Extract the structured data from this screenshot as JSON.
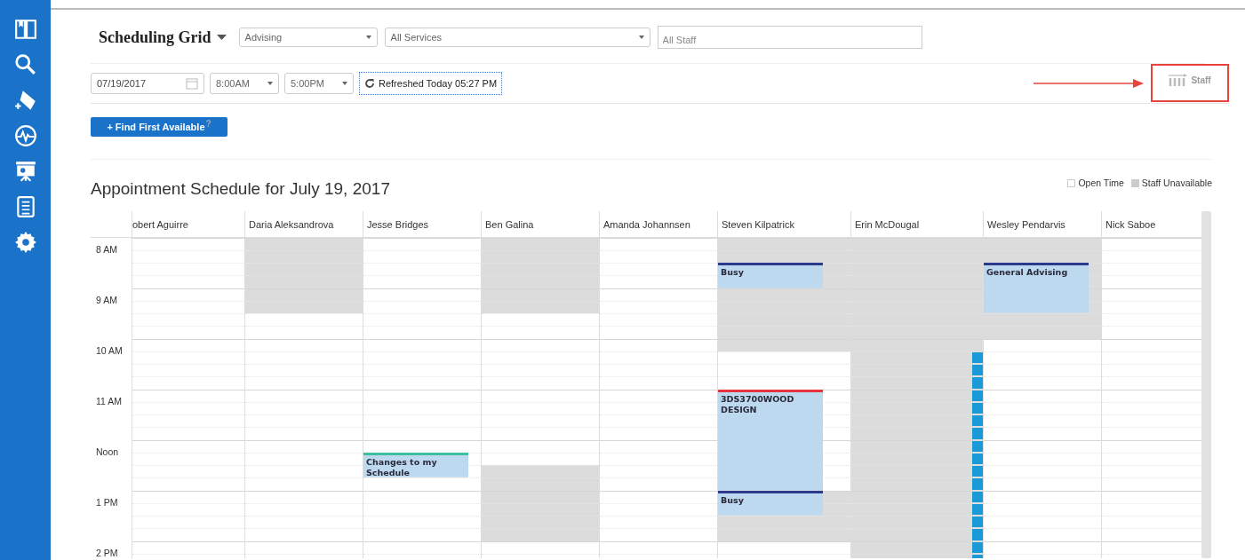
{
  "header": {
    "title": "Scheduling Grid",
    "selects": [
      {
        "value": "Advising"
      },
      {
        "value": "All Services"
      }
    ],
    "staff_field": {
      "placeholder": "All Staff"
    }
  },
  "filters": {
    "date": "07/19/2017",
    "start_time": "8:00AM",
    "end_time": "5:00PM",
    "refresh_button": "Refreshed Today 05:27 PM",
    "view_toggle": "Staff"
  },
  "find_button": {
    "label": "+ Find First Available",
    "help": "?"
  },
  "schedule": {
    "title": "Appointment Schedule for July 19, 2017",
    "legend": [
      {
        "label": "Open Time",
        "kind": "open"
      },
      {
        "label": "Staff Unavailable",
        "kind": "unavailable"
      }
    ],
    "hours": [
      "8 AM",
      "9 AM",
      "10 AM",
      "11 AM",
      "Noon",
      "1 PM",
      "2 PM"
    ],
    "staff": [
      {
        "name": "obert Aguirre",
        "slots": [
          {
            "unavailable": false
          },
          {
            "unavailable": false
          },
          {
            "unavailable": false
          },
          {
            "unavailable": false
          },
          {
            "unavailable": false
          },
          {
            "unavailable": false
          },
          {
            "unavailable": false
          },
          {
            "unavailable": false
          },
          {
            "unavailable": false
          },
          {
            "unavailable": false
          },
          {
            "unavailable": false
          },
          {
            "unavailable": false
          },
          {
            "unavailable": false
          },
          {
            "unavailable": false
          },
          {
            "unavailable": false
          },
          {
            "unavailable": false
          },
          {
            "unavailable": false
          },
          {
            "unavailable": false
          },
          {
            "unavailable": false
          },
          {
            "unavailable": false
          },
          {
            "unavailable": false
          },
          {
            "unavailable": false
          },
          {
            "unavailable": false
          },
          {
            "unavailable": false
          },
          {
            "unavailable": false
          },
          {
            "unavailable": false
          }
        ]
      },
      {
        "name": "Daria Aleksandrova",
        "slots": [
          {
            "unavailable": true
          },
          {
            "unavailable": true
          },
          {
            "unavailable": true
          },
          {
            "unavailable": true
          },
          {
            "unavailable": true
          },
          {
            "unavailable": true
          },
          {
            "unavailable": false
          },
          {
            "unavailable": false
          },
          {
            "unavailable": false
          },
          {
            "unavailable": false
          },
          {
            "unavailable": false
          },
          {
            "unavailable": false
          },
          {
            "unavailable": false
          },
          {
            "unavailable": false
          },
          {
            "unavailable": false
          },
          {
            "unavailable": false
          },
          {
            "unavailable": false
          },
          {
            "unavailable": false
          },
          {
            "unavailable": false
          },
          {
            "unavailable": false
          },
          {
            "unavailable": false
          },
          {
            "unavailable": false
          },
          {
            "unavailable": false
          },
          {
            "unavailable": false
          },
          {
            "unavailable": false
          },
          {
            "unavailable": false
          }
        ]
      },
      {
        "name": "Jesse Bridges",
        "slots": [
          {
            "unavailable": false
          },
          {
            "unavailable": false
          },
          {
            "unavailable": false
          },
          {
            "unavailable": false
          },
          {
            "unavailable": false
          },
          {
            "unavailable": false
          },
          {
            "unavailable": false
          },
          {
            "unavailable": false
          },
          {
            "unavailable": false
          },
          {
            "unavailable": false
          },
          {
            "unavailable": false
          },
          {
            "unavailable": false
          },
          {
            "unavailable": false
          },
          {
            "unavailable": false
          },
          {
            "unavailable": false
          },
          {
            "unavailable": false
          },
          {
            "unavailable": false
          },
          {
            "unavailable": false,
            "appointment": {
              "title": "Changes to my Schedule",
              "color": "#3cc0a0"
            }
          },
          {
            "unavailable": false,
            "continued": true
          },
          {
            "unavailable": false
          },
          {
            "unavailable": false
          },
          {
            "unavailable": false
          },
          {
            "unavailable": false
          },
          {
            "unavailable": false
          },
          {
            "unavailable": false
          },
          {
            "unavailable": false
          }
        ]
      },
      {
        "name": "Ben Galina",
        "slots": [
          {
            "unavailable": true
          },
          {
            "unavailable": true
          },
          {
            "unavailable": true
          },
          {
            "unavailable": true
          },
          {
            "unavailable": true
          },
          {
            "unavailable": true
          },
          {
            "unavailable": false
          },
          {
            "unavailable": false
          },
          {
            "unavailable": false
          },
          {
            "unavailable": false
          },
          {
            "unavailable": false
          },
          {
            "unavailable": false
          },
          {
            "unavailable": false
          },
          {
            "unavailable": false
          },
          {
            "unavailable": false
          },
          {
            "unavailable": false
          },
          {
            "unavailable": false
          },
          {
            "unavailable": false
          },
          {
            "unavailable": true
          },
          {
            "unavailable": true
          },
          {
            "unavailable": true
          },
          {
            "unavailable": true
          },
          {
            "unavailable": true
          },
          {
            "unavailable": true
          },
          {
            "unavailable": false
          },
          {
            "unavailable": false
          }
        ]
      },
      {
        "name": "Amanda Johannsen",
        "slots": [
          {
            "unavailable": false
          },
          {
            "unavailable": false
          },
          {
            "unavailable": false
          },
          {
            "unavailable": false
          },
          {
            "unavailable": false
          },
          {
            "unavailable": false
          },
          {
            "unavailable": false
          },
          {
            "unavailable": false
          },
          {
            "unavailable": false
          },
          {
            "unavailable": false
          },
          {
            "unavailable": false
          },
          {
            "unavailable": false
          },
          {
            "unavailable": false
          },
          {
            "unavailable": false
          },
          {
            "unavailable": false
          },
          {
            "unavailable": false
          },
          {
            "unavailable": false
          },
          {
            "unavailable": false
          },
          {
            "unavailable": false
          },
          {
            "unavailable": false
          },
          {
            "unavailable": false
          },
          {
            "unavailable": false
          },
          {
            "unavailable": false
          },
          {
            "unavailable": false
          },
          {
            "unavailable": false
          },
          {
            "unavailable": false
          }
        ]
      },
      {
        "name": "Steven Kilpatrick",
        "slots": [
          {
            "unavailable": true
          },
          {
            "unavailable": true
          },
          {
            "unavailable": true,
            "appointment": {
              "title": "Busy",
              "color": "#2b3a8c"
            }
          },
          {
            "unavailable": true,
            "continued": true
          },
          {
            "unavailable": true
          },
          {
            "unavailable": true
          },
          {
            "unavailable": true
          },
          {
            "unavailable": true
          },
          {
            "unavailable": true
          },
          {
            "unavailable": false
          },
          {
            "unavailable": false
          },
          {
            "unavailable": false
          },
          {
            "unavailable": false,
            "appointment": {
              "title": "3DS3700WOOD DESIGN",
              "color": "#e8333c"
            }
          },
          {
            "unavailable": false,
            "continued": true
          },
          {
            "unavailable": false,
            "continued": true
          },
          {
            "unavailable": false,
            "continued": true
          },
          {
            "unavailable": false,
            "continued": true
          },
          {
            "unavailable": false,
            "continued": true
          },
          {
            "unavailable": false,
            "continued": true
          },
          {
            "unavailable": false,
            "continued": true
          },
          {
            "unavailable": true,
            "appointment": {
              "title": "Busy",
              "color": "#2b3a8c"
            }
          },
          {
            "unavailable": true,
            "continued": true
          },
          {
            "unavailable": true
          },
          {
            "unavailable": true
          },
          {
            "unavailable": false
          },
          {
            "unavailable": false
          }
        ]
      },
      {
        "name": "Erin McDougal",
        "slots": [
          {
            "unavailable": true
          },
          {
            "unavailable": true
          },
          {
            "unavailable": true
          },
          {
            "unavailable": true
          },
          {
            "unavailable": true
          },
          {
            "unavailable": true
          },
          {
            "unavailable": true
          },
          {
            "unavailable": true
          },
          {
            "unavailable": true
          },
          {
            "unavailable": true,
            "bar": true
          },
          {
            "unavailable": true,
            "bar": true
          },
          {
            "unavailable": true,
            "bar": true
          },
          {
            "unavailable": true,
            "bar": true
          },
          {
            "unavailable": true,
            "bar": true
          },
          {
            "unavailable": true,
            "bar": true
          },
          {
            "unavailable": true,
            "bar": true
          },
          {
            "unavailable": true,
            "bar": true
          },
          {
            "unavailable": true,
            "bar": true
          },
          {
            "unavailable": true,
            "bar": true
          },
          {
            "unavailable": true,
            "bar": true
          },
          {
            "unavailable": true,
            "bar": true
          },
          {
            "unavailable": true,
            "bar": true
          },
          {
            "unavailable": true,
            "bar": true
          },
          {
            "unavailable": true,
            "bar": true
          },
          {
            "unavailable": true,
            "bar": true
          },
          {
            "unavailable": true,
            "bar": true
          }
        ]
      },
      {
        "name": "Wesley Pendarvis",
        "slots": [
          {
            "unavailable": true
          },
          {
            "unavailable": true
          },
          {
            "unavailable": true,
            "appointment": {
              "title": "General Advising",
              "color": "#2b3a8c"
            }
          },
          {
            "unavailable": true,
            "continued": true
          },
          {
            "unavailable": true,
            "continued": true
          },
          {
            "unavailable": true,
            "continued": true
          },
          {
            "unavailable": true
          },
          {
            "unavailable": true
          },
          {
            "unavailable": false
          },
          {
            "unavailable": false
          },
          {
            "unavailable": false
          },
          {
            "unavailable": false
          },
          {
            "unavailable": false
          },
          {
            "unavailable": false
          },
          {
            "unavailable": false
          },
          {
            "unavailable": false
          },
          {
            "unavailable": false
          },
          {
            "unavailable": false
          },
          {
            "unavailable": false
          },
          {
            "unavailable": false
          },
          {
            "unavailable": false
          },
          {
            "unavailable": false
          },
          {
            "unavailable": false
          },
          {
            "unavailable": false
          },
          {
            "unavailable": false
          },
          {
            "unavailable": false
          }
        ]
      },
      {
        "name": "Nick Saboe",
        "slots": [
          {
            "unavailable": false
          },
          {
            "unavailable": false
          },
          {
            "unavailable": false
          },
          {
            "unavailable": false
          },
          {
            "unavailable": false
          },
          {
            "unavailable": false
          },
          {
            "unavailable": false
          },
          {
            "unavailable": false
          },
          {
            "unavailable": false
          },
          {
            "unavailable": false
          },
          {
            "unavailable": false
          },
          {
            "unavailable": false
          },
          {
            "unavailable": false
          },
          {
            "unavailable": false
          },
          {
            "unavailable": false
          },
          {
            "unavailable": false
          },
          {
            "unavailable": false
          },
          {
            "unavailable": false
          },
          {
            "unavailable": false
          },
          {
            "unavailable": false
          },
          {
            "unavailable": false
          },
          {
            "unavailable": false
          },
          {
            "unavailable": false
          },
          {
            "unavailable": false
          },
          {
            "unavailable": false
          },
          {
            "unavailable": false
          }
        ]
      }
    ]
  }
}
